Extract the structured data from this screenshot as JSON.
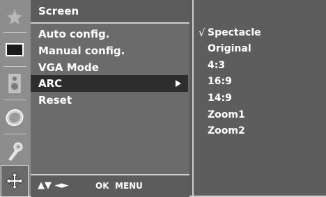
{
  "menu": {
    "title": "Screen",
    "items": [
      {
        "label": "Auto config."
      },
      {
        "label": "Manual config."
      },
      {
        "label": "VGA Mode"
      },
      {
        "label": "ARC"
      },
      {
        "label": "Reset"
      }
    ],
    "selected_item": "ARC",
    "footer": {
      "nav": "▲▼ ◄►",
      "ok": "OK",
      "menu": "MENU"
    }
  },
  "submenu": {
    "check_mark": "√",
    "checked_option": "Spectacle",
    "options": [
      {
        "label": "Spectacle"
      },
      {
        "label": "Original"
      },
      {
        "label": "4:3"
      },
      {
        "label": "16:9"
      },
      {
        "label": "14:9"
      },
      {
        "label": "Zoom1"
      },
      {
        "label": "Zoom2"
      }
    ]
  },
  "sidebar": {
    "icons": [
      "picture-effects-icon",
      "screen-icon",
      "speaker-icon",
      "clock-icon",
      "key-icon",
      "screen-adjust-icon"
    ],
    "active_icon": "screen-adjust-icon"
  },
  "colors": {
    "panel": "#6b6b6b",
    "selected_row": "#2d2d2d",
    "text": "#ffffff"
  }
}
